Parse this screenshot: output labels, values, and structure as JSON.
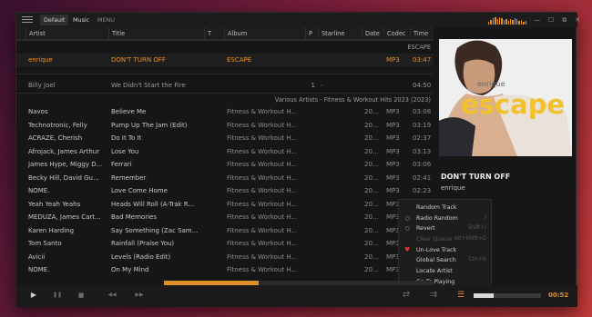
{
  "titlebar": {
    "tabs": [
      {
        "label": "Default"
      },
      {
        "label": "Music"
      }
    ],
    "menu_label": "MENU",
    "window_buttons": {
      "minimize": "—",
      "maximize": "☐",
      "restore": "⧉",
      "close": "✕"
    }
  },
  "columns": [
    "Artist",
    "Title",
    "T",
    "Album",
    "P",
    "Starline",
    "Date",
    "Codec",
    "Time"
  ],
  "groups": [
    "ESCAPE",
    "Various Artists - Fitness & Workout Hits 2023 (2023)"
  ],
  "active_track": {
    "artist": "enrique",
    "title": "DON'T TURN OFF",
    "album": "ESCAPE",
    "codec": "MP3",
    "time": "03:47"
  },
  "single_track": {
    "artist": "Billy Joel",
    "title": "We Didn't Start the Fire",
    "p": "1",
    "starline": "·",
    "time": "04:50"
  },
  "tracks": [
    {
      "artist": "Navos",
      "title": "Believe Me",
      "album": "Fitness & Workout H...",
      "date": "202...",
      "codec": "MP3",
      "time": "03:08"
    },
    {
      "artist": "Technotronic, Felly",
      "title": "Pump Up The Jam (Edit)",
      "album": "Fitness & Workout H...",
      "date": "202...",
      "codec": "MP3",
      "time": "03:19"
    },
    {
      "artist": "ACRAZE, Cherish",
      "title": "Do It To It",
      "album": "Fitness & Workout H...",
      "date": "202...",
      "codec": "MP3",
      "time": "02:37"
    },
    {
      "artist": "Afrojack, James Arthur",
      "title": "Lose You",
      "album": "Fitness & Workout H...",
      "date": "202...",
      "codec": "MP3",
      "time": "03:13"
    },
    {
      "artist": "James Hype, Miggy D...",
      "title": "Ferrari",
      "album": "Fitness & Workout H...",
      "date": "202...",
      "codec": "MP3",
      "time": "03:06"
    },
    {
      "artist": "Becky Hill, David Gu...",
      "title": "Remember",
      "album": "Fitness & Workout H...",
      "date": "202...",
      "codec": "MP3",
      "time": "02:41"
    },
    {
      "artist": "NOME.",
      "title": "Love Come Home",
      "album": "Fitness & Workout H...",
      "date": "202...",
      "codec": "MP3",
      "time": "02:23"
    },
    {
      "artist": "Yeah Yeah Yeahs",
      "title": "Heads Will Roll (A-Trak R...",
      "album": "Fitness & Workout H...",
      "date": "202...",
      "codec": "MP3",
      "time": "03:25"
    },
    {
      "artist": "MEDUZA, James Cart...",
      "title": "Bad Memories",
      "album": "Fitness & Workout H...",
      "date": "202...",
      "codec": "MP3",
      "time": "02:28"
    },
    {
      "artist": "Karen Harding",
      "title": "Say Something (Zac Sam...",
      "album": "Fitness & Workout H...",
      "date": "202...",
      "codec": "MP3",
      "time": "03:06"
    },
    {
      "artist": "Tom Santo",
      "title": "Rainfall (Praise You)",
      "album": "Fitness & Workout H...",
      "date": "202...",
      "codec": "MP3",
      "time": "02:49"
    },
    {
      "artist": "Avicii",
      "title": "Levels (Radio Edit)",
      "album": "Fitness & Workout H...",
      "date": "202...",
      "codec": "MP3",
      "time": "03:19"
    },
    {
      "artist": "NOME.",
      "title": "On My Mind",
      "album": "Fitness & Workout H...",
      "date": "202...",
      "codec": "MP3",
      "time": "03:02"
    }
  ],
  "album_art": {
    "artist_text": "enrique",
    "album_text": "escape"
  },
  "now_playing": {
    "title": "DON'T TURN OFF",
    "artist": "enrique"
  },
  "context_menu": [
    {
      "label": "Random Track",
      "shortcut": "",
      "marker": "",
      "disabled": false
    },
    {
      "label": "Radio Random",
      "shortcut": "/",
      "marker": "radio",
      "disabled": false
    },
    {
      "label": "Revert",
      "shortcut": "Shift+/",
      "marker": "radio",
      "disabled": false
    },
    {
      "label": "Clear Queue",
      "shortcut": "Alt+Shift+Q",
      "marker": "",
      "disabled": true
    },
    {
      "label": "Un-Love Track",
      "shortcut": "",
      "marker": "heart",
      "disabled": false
    },
    {
      "label": "Global Search",
      "shortcut": "Ctrl+G",
      "marker": "",
      "disabled": false
    },
    {
      "label": "Locate Artist",
      "shortcut": "",
      "marker": "",
      "disabled": false
    },
    {
      "label": "Go To Playing",
      "shortcut": "",
      "marker": "",
      "disabled": false
    }
  ],
  "controls": {
    "play": "▶",
    "pause": "❚❚",
    "stop": "■",
    "prev": "◀◀",
    "next": "▶▶",
    "repeat": "⇄",
    "shuffle": "⇉",
    "menu": "☰"
  },
  "progress": 0.35,
  "volume": 0.3,
  "current_time": "00:52",
  "colors": {
    "accent": "#e0902a",
    "background": "#161616",
    "heart": "#e0303a"
  }
}
